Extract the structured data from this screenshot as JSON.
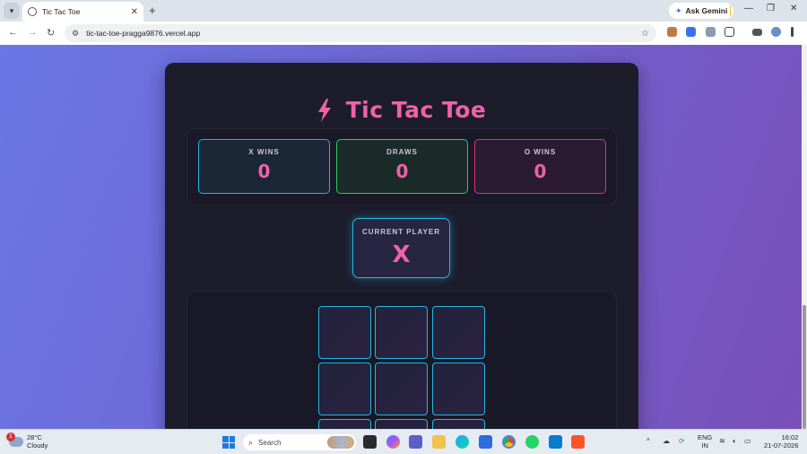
{
  "browser": {
    "tab_title": "Tic Tac Toe",
    "tab_close": "✕",
    "new_tab": "+",
    "ask_label": "Ask Gemini",
    "url": "tic-tac-toe-pragga9876.vercel.app",
    "window_controls": {
      "minimize": "—",
      "restore": "❐",
      "close": "✕"
    }
  },
  "game": {
    "title": "Tic Tac Toe",
    "scores": {
      "x": {
        "label": "X WINS",
        "value": "0"
      },
      "draws": {
        "label": "DRAWS",
        "value": "0"
      },
      "o": {
        "label": "O WINS",
        "value": "0"
      }
    },
    "current_player": {
      "label": "CURRENT PLAYER",
      "value": "X"
    },
    "board": [
      "",
      "",
      "",
      "",
      "",
      "",
      "",
      "",
      ""
    ]
  },
  "taskbar": {
    "weather_badge": "1",
    "temperature": "28°C",
    "condition": "Cloudy",
    "search_placeholder": "Search",
    "lang_line1": "ENG",
    "lang_line2": "IN",
    "time": "16:02",
    "date": "21-07-2026"
  },
  "colors": {
    "accent_pink": "#f062a8",
    "accent_cyan": "#27b6e0",
    "accent_green": "#2bcb5e",
    "accent_magenta": "#e0337d"
  }
}
